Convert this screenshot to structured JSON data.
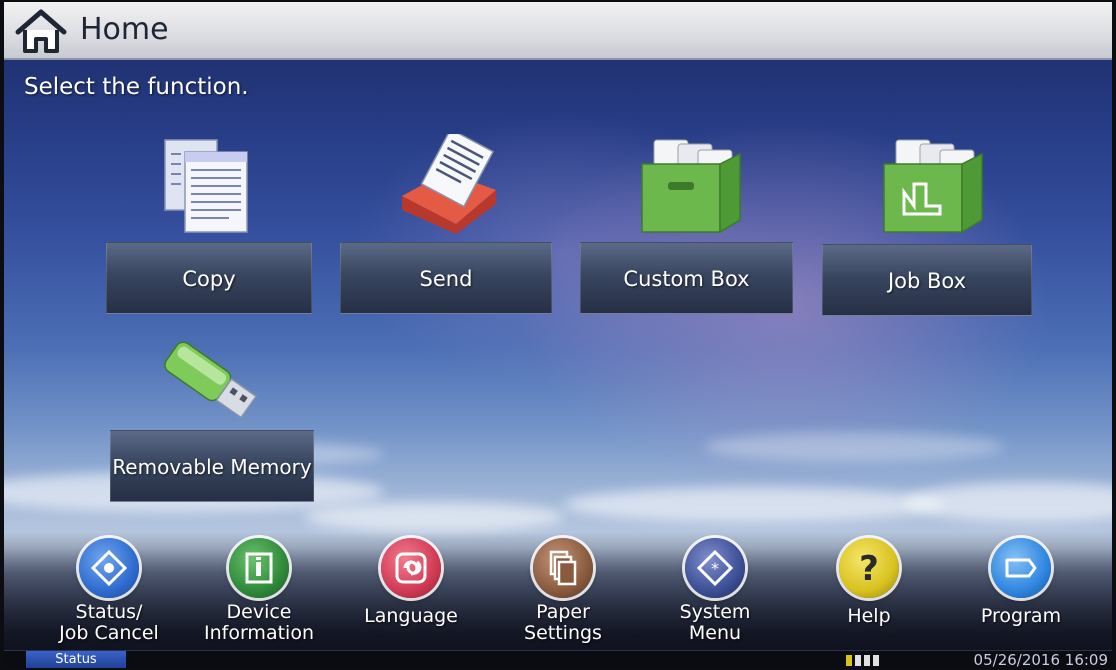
{
  "header": {
    "title": "Home",
    "icon": "home-icon"
  },
  "prompt": "Select the function.",
  "functions": [
    {
      "label": "Copy",
      "icon": "copy-icon"
    },
    {
      "label": "Send",
      "icon": "send-icon"
    },
    {
      "label": "Custom Box",
      "icon": "custom-box-icon"
    },
    {
      "label": "Job Box",
      "icon": "job-box-icon"
    },
    {
      "label": "Removable Memory",
      "icon": "usb-drive-icon"
    }
  ],
  "bottom_bar": [
    {
      "line1": "Status/",
      "line2": "Job Cancel",
      "icon": "status-icon",
      "color": "#2f6cd0"
    },
    {
      "line1": "Device",
      "line2": "Information",
      "icon": "device-info-icon",
      "color": "#2e8a3a"
    },
    {
      "line1": "Language",
      "line2": "",
      "icon": "language-icon",
      "color": "#d23a55"
    },
    {
      "line1": "Paper",
      "line2": "Settings",
      "icon": "paper-settings-icon",
      "color": "#8a5a3e"
    },
    {
      "line1": "System",
      "line2": "Menu",
      "icon": "system-menu-icon",
      "color": "#3d4f95"
    },
    {
      "line1": "Help",
      "line2": "",
      "icon": "help-icon",
      "color": "#d8c21f"
    },
    {
      "line1": "Program",
      "line2": "",
      "icon": "program-icon",
      "color": "#2f86e0"
    }
  ],
  "status_bar": {
    "tab": "Status",
    "datetime": "05/26/2016 16:09"
  }
}
